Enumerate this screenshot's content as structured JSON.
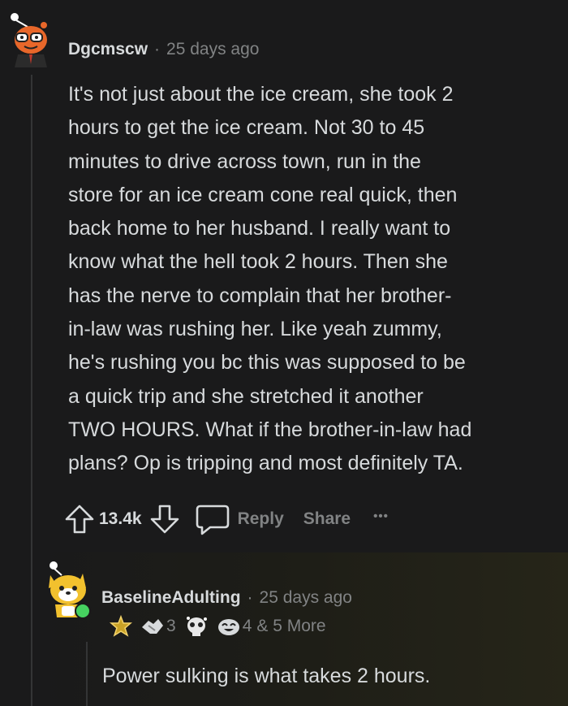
{
  "comment": {
    "author": "Dgcmscw",
    "separator": "·",
    "time": "25 days ago",
    "body_lines": [
      "It's not just about the ice cream, she took 2",
      "hours to get the ice cream. Not 30 to 45",
      "minutes to drive across town, run in the",
      "store for an ice cream cone real quick, then",
      "back home to her husband. I really want to",
      "know what the hell took 2 hours. Then she",
      "has the nerve to complain that her brother-",
      "in-law was rushing her. Like yeah zummy,",
      "he's rushing you bc this was supposed to be",
      "a quick trip and she stretched it another",
      "TWO HOURS. What if the brother-in-law had",
      "plans? Op is tripping and most definitely TA."
    ],
    "votes": "13.4k",
    "reply_label": "Reply",
    "share_label": "Share",
    "more_label": "•••"
  },
  "reply": {
    "author": "BaselineAdulting",
    "separator": "·",
    "time": "25 days ago",
    "awards": {
      "award_2_count": "3",
      "award_4_count": "4",
      "more_text": "& 5 More"
    },
    "body": "Power sulking is what takes 2 hours."
  },
  "colors": {
    "background": "#1a1a1b",
    "text": "#d7dadc",
    "muted": "#818384",
    "thread_line": "#343536",
    "online": "#46d160",
    "avatar_orange": "#e8672a"
  },
  "icons": [
    "snoo-avatar",
    "snoo-dog-avatar",
    "upvote-icon",
    "downvote-icon",
    "comment-icon",
    "more-icon",
    "online-indicator",
    "award-icons"
  ]
}
